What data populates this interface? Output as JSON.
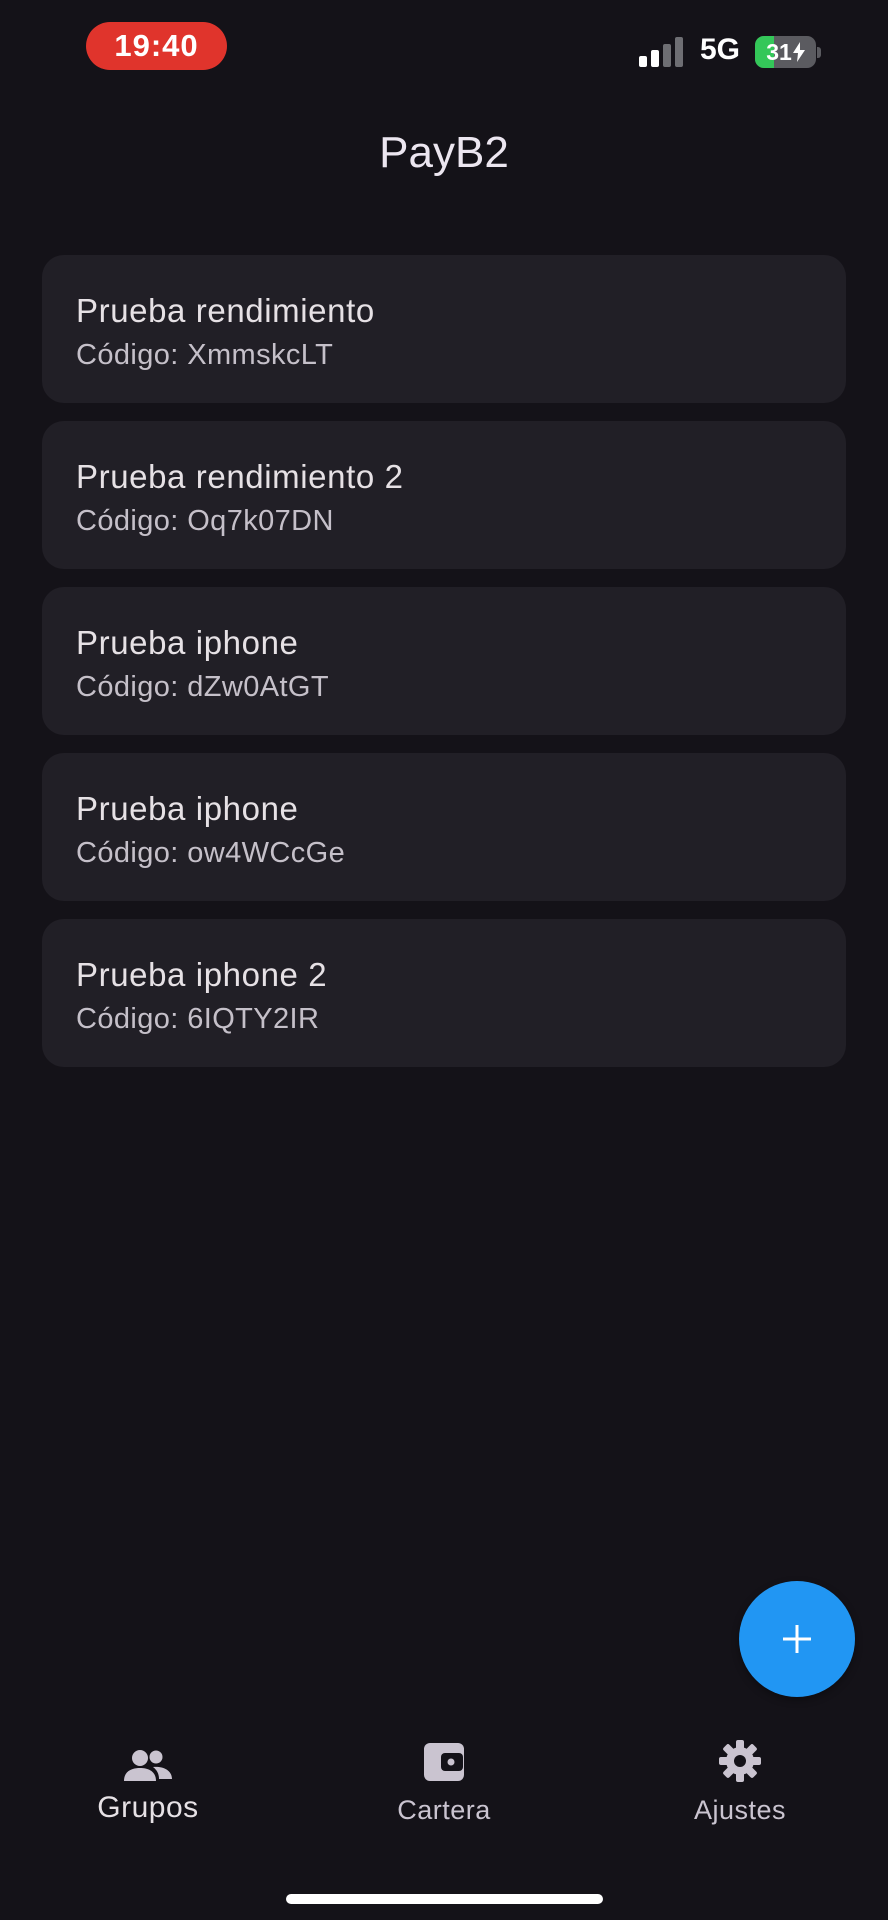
{
  "status_bar": {
    "time": "19:40",
    "network": "5G",
    "battery_label": "31",
    "battery_level": 0.31,
    "signal_bars": 2
  },
  "app": {
    "title": "PayB2"
  },
  "groups": [
    {
      "name": "Prueba rendimiento",
      "code": "Código: XmmskcLT"
    },
    {
      "name": "Prueba rendimiento 2",
      "code": "Código: Oq7k07DN"
    },
    {
      "name": "Prueba iphone",
      "code": "Código: dZw0AtGT"
    },
    {
      "name": "Prueba iphone",
      "code": "Código: ow4WCcGe"
    },
    {
      "name": "Prueba iphone 2",
      "code": "Código: 6IQTY2IR"
    }
  ],
  "fab": {
    "icon": "plus-icon"
  },
  "nav": {
    "items": [
      {
        "label": "Grupos",
        "icon": "group-icon",
        "active": true
      },
      {
        "label": "Cartera",
        "icon": "wallet-icon",
        "active": false
      },
      {
        "label": "Ajustes",
        "icon": "gear-icon",
        "active": false
      }
    ]
  },
  "colors": {
    "background": "#141218",
    "card": "#211f26",
    "fab": "#2196f3",
    "time_pill": "#e0342c",
    "battery_fill": "#34c759"
  }
}
